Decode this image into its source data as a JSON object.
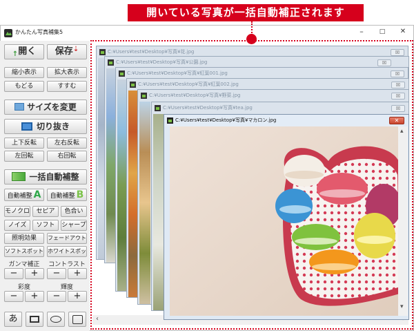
{
  "callout": {
    "text": "開いている写真が一括自動補正されます"
  },
  "app": {
    "title": "かんたん写真補集5",
    "window_controls": {
      "minimize": "–",
      "maximize": "□",
      "close": "✕"
    }
  },
  "sidebar": {
    "open": "開く",
    "save": "保存",
    "shrink": "縮小表示",
    "enlarge": "拡大表示",
    "undo": "もどる",
    "redo": "すすむ",
    "resize": "サイズを変更",
    "crop": "切り抜き",
    "flip_v": "上下反転",
    "flip_h": "左右反転",
    "rot_left": "左回転",
    "rot_right": "右回転",
    "batch": "一括自動補整",
    "auto_a": "自動補整",
    "auto_a_letter": "A",
    "auto_b": "自動補整",
    "auto_b_letter": "B",
    "mono": "モノクロ",
    "sepia": "セピア",
    "tone": "色合い",
    "noise": "ノイズ",
    "soft": "ソフト",
    "sharp": "シャープ",
    "light": "照明効果",
    "fade": "フェードアウト",
    "softspot": "ソフトスポット",
    "whitespot": "ホワイトスポット",
    "gamma": "ガンマ補正",
    "contrast": "コントラスト",
    "saturation": "彩度",
    "brightness": "輝度",
    "minus": "−",
    "plus": "+",
    "text_tool": "あ"
  },
  "windows": [
    {
      "title": "C:¥Users¥test¥Desktop¥写真¥花.jpg",
      "close": "☒"
    },
    {
      "title": "C:¥Users¥test¥Desktop¥写真¥公園.jpg",
      "close": "☒"
    },
    {
      "title": "C:¥Users¥test¥Desktop¥写真¥紅葉001.jpg",
      "close": "☒"
    },
    {
      "title": "C:¥Users¥test¥Desktop¥写真¥紅葉002.jpg",
      "close": "☒"
    },
    {
      "title": "C:¥Users¥test¥Desktop¥写真¥野菜.jpg",
      "close": "☒"
    },
    {
      "title": "C:¥Users¥test¥Desktop¥写真¥tea.jpg",
      "close": "☒"
    }
  ],
  "front_window": {
    "title": "C:¥Users¥test¥Desktop¥写真¥マカロン.jpg",
    "close": "✕"
  },
  "scroll": {
    "up": "▴",
    "down": "▾",
    "left": "‹",
    "right": "›"
  }
}
